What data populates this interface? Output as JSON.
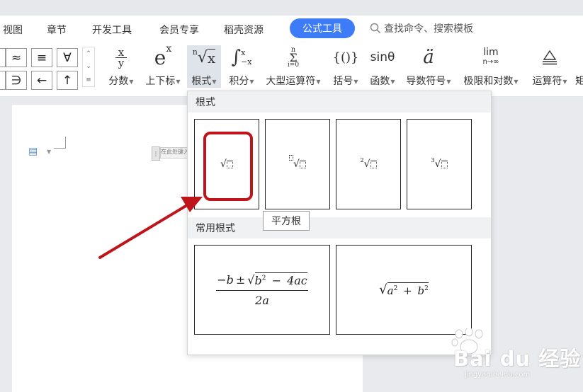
{
  "menu": {
    "tabs": [
      "视图",
      "章节",
      "开发工具",
      "会员专享",
      "稻壳资源"
    ],
    "active_tab": "公式工具",
    "search_placeholder": "查找命令、搜索模板"
  },
  "symbols": [
    "≈",
    "≡",
    "∀",
    "∋",
    "←",
    "↑"
  ],
  "spinner": {
    "up": "⌃",
    "down": "⌄",
    "more": "≡"
  },
  "tools": [
    {
      "icon": "fraction-icon",
      "label": "分数"
    },
    {
      "icon": "script-icon",
      "label": "上下标",
      "glyph": "e",
      "glyph_sup": "x"
    },
    {
      "icon": "radical-icon",
      "label": "根式"
    },
    {
      "icon": "integral-icon",
      "label": "积分"
    },
    {
      "icon": "large-operator-icon",
      "label": "大型运算符"
    },
    {
      "icon": "bracket-icon",
      "label": "括号",
      "glyph": "{()}"
    },
    {
      "icon": "function-icon",
      "label": "函数",
      "glyph": "sinθ"
    },
    {
      "icon": "accent-icon",
      "label": "导数符号",
      "glyph": "ä"
    },
    {
      "icon": "limit-icon",
      "label": "极限和对数",
      "glyph": "lim",
      "glyph_sub": "n→∞"
    },
    {
      "icon": "operator-icon",
      "label": "运算符"
    },
    {
      "icon": "matrix-icon",
      "label": "矩"
    }
  ],
  "icon_glyphs": {
    "frac_num": "x",
    "frac_den": "y",
    "radical_index": "n",
    "radical_body": "x",
    "integral_sym": "∫",
    "integral_upper": "x",
    "integral_lower": "−x",
    "sum_upper": "n",
    "sum_sym": "Σ",
    "sum_lower": "i=0"
  },
  "dropdown": {
    "radicals_header": "根式",
    "common_header": "常用根式",
    "tooltip": "平方根",
    "radical_indices": [
      "2",
      "3"
    ],
    "quadratic": {
      "b": "b",
      "minus_b": "−b",
      "pm": "±",
      "b_sq": "b",
      "exp": "2",
      "minus": "−",
      "four_ac": "4ac",
      "two_a": "2a"
    },
    "pythagoras": {
      "a": "a",
      "exp": "2",
      "plus": "+",
      "b": "b"
    }
  },
  "document": {
    "inline_text": "在此处键入公式。"
  },
  "watermark": {
    "brand": "Bai du 经验",
    "url": "jingyan.baidu.com"
  },
  "colors": {
    "accent": "#3d7bf7",
    "highlight": "#c0141c",
    "arrow": "#c0141c"
  }
}
